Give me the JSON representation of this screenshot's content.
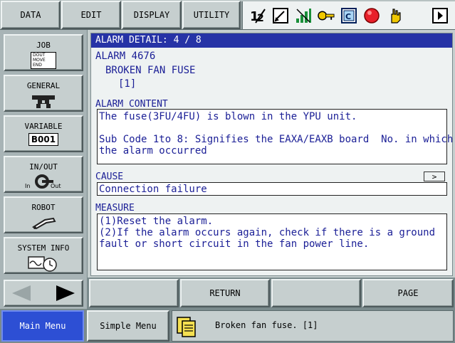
{
  "menubar": {
    "items": [
      "DATA",
      "EDIT",
      "DISPLAY",
      "UTILITY"
    ],
    "status_icons": [
      "coordinate-icon",
      "edit-mode-icon",
      "signal-strength-icon",
      "key-icon",
      "teach-mode-icon",
      "stop-icon",
      "hand-icon",
      "next-page-icon"
    ]
  },
  "sidebar": {
    "items": [
      {
        "label": "JOB",
        "icon": "job-icon",
        "icon_text": [
          "DOUT",
          "MOVE",
          "END"
        ]
      },
      {
        "label": "GENERAL",
        "icon": "general-icon"
      },
      {
        "label": "VARIABLE",
        "icon": "variable-icon",
        "icon_text": "B001"
      },
      {
        "label": "IN/OUT",
        "icon": "in-out-icon",
        "icon_in": "In",
        "icon_out": "Out"
      },
      {
        "label": "ROBOT",
        "icon": "robot-icon"
      },
      {
        "label": "SYSTEM INFO",
        "icon": "system-info-icon"
      }
    ]
  },
  "detail": {
    "title": "ALARM DETAIL: 4 / 8",
    "alarm_code": "ALARM 4676",
    "alarm_name": "BROKEN FAN FUSE",
    "alarm_sub": "[1]",
    "content_label": "ALARM CONTENT",
    "content_line1": "The fuse(3FU/4FU) is blown in the YPU unit.",
    "content_line2": "Sub Code 1to 8: Signifies the EAXA/EAXB board  No. in which",
    "content_line3": "the alarm occurred",
    "cause_label": "CAUSE",
    "cause_arrow": ">",
    "cause_text": "Connection failure",
    "measure_label": "MEASURE",
    "measure_line1": "(1)Reset the alarm.",
    "measure_line2": "(2)If the alarm occurs again, check if there is a ground",
    "measure_line3": "fault or short circuit in the fan power line."
  },
  "fkeys": [
    "",
    "RETURN",
    "",
    "PAGE"
  ],
  "bottombar": {
    "main_menu": "Main Menu",
    "simple_menu": "Simple Menu",
    "message": "Broken fan fuse. [1]"
  },
  "colors": {
    "title_bg": "#2633a6",
    "text": "#1a1e96",
    "main_menu_bg": "#2d4fd4",
    "panel": "#c6cfcf"
  }
}
